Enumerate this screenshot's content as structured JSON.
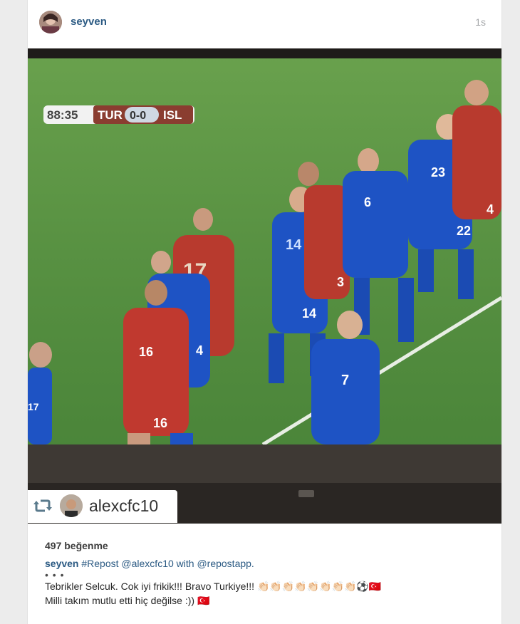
{
  "post": {
    "username": "seyven",
    "time_ago": "1s",
    "avatar_icon": "user-avatar"
  },
  "media": {
    "scoreboard": {
      "clock": "88:35",
      "home": "TUR",
      "score": "0-0",
      "away": "ISL"
    },
    "jersey_numbers": [
      "17",
      "16",
      "16",
      "4",
      "14",
      "14",
      "3",
      "6",
      "23",
      "22",
      "4",
      "7",
      "17"
    ],
    "repost_tag": {
      "icon": "repost-icon",
      "username": "alexcfc10"
    }
  },
  "info": {
    "likes": "497 beğenme",
    "caption": {
      "username": "seyven",
      "text": "#Repost @alexcfc10 with @repostapp."
    },
    "more": "• • •",
    "comment": "Tebrikler Selcuk. Cok iyi frikik!!! Bravo Turkiye!!! 👏🏻👏🏻👏🏻👏🏻👏🏻👏🏻👏🏻👏🏻⚽️🇹🇷\nMilli takım mutlu etti hiç değilse :)) 🇹🇷"
  },
  "colors": {
    "link": "#2b5a83",
    "turkey_kit": "#b83a2e",
    "iceland_kit": "#1e53c4",
    "pitch": "#4d8a3a"
  }
}
